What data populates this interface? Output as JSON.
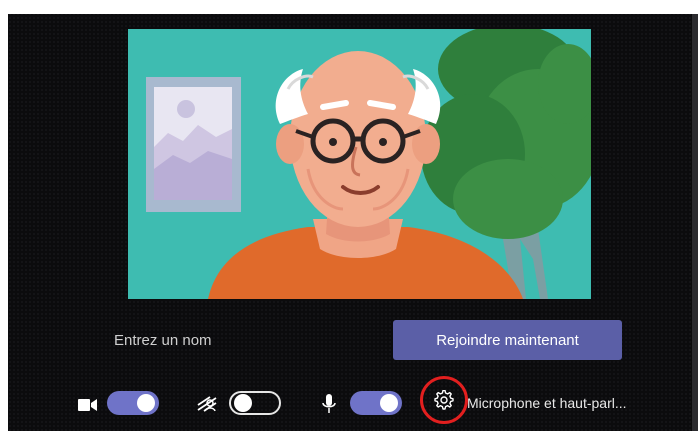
{
  "prejoin": {
    "name_placeholder": "Entrez un nom",
    "name_value": "",
    "join_label": "Rejoindre maintenant"
  },
  "controls": {
    "camera": {
      "icon": "camera-icon",
      "toggle_on": true
    },
    "background": {
      "icon": "background-blur-icon",
      "toggle_on": false
    },
    "microphone": {
      "icon": "microphone-icon",
      "toggle_on": true
    },
    "settings": {
      "icon": "gear-icon"
    },
    "device_label": "Microphone et haut-parl..."
  },
  "colors": {
    "accent": "#5b5fa7",
    "toggle_on": "#6f73c8",
    "highlight_ring": "#e21f1f",
    "video_background": "#3ebcb1"
  }
}
